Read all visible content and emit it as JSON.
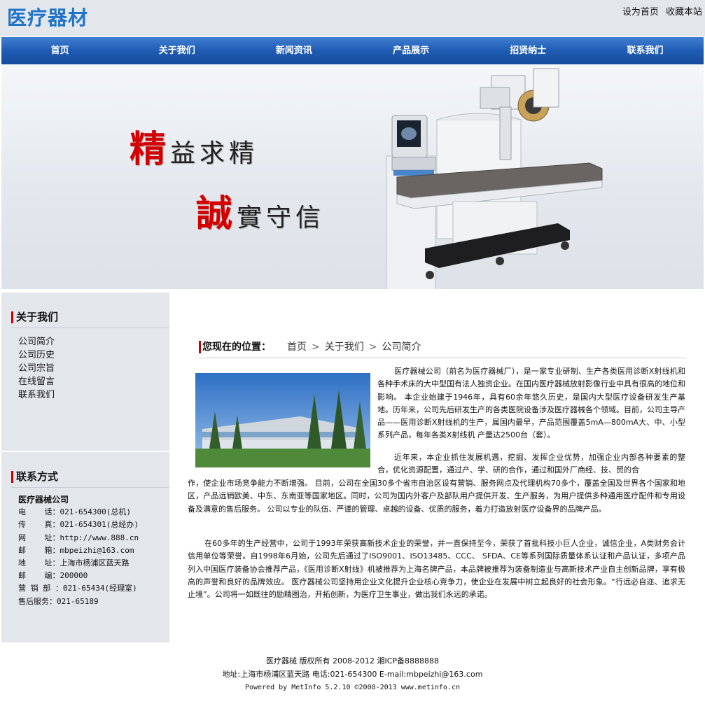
{
  "header": {
    "logo": "医疗器材",
    "set_home": "设为首页",
    "add_fav": "收藏本站"
  },
  "nav": [
    "首页",
    "关于我们",
    "新闻资讯",
    "产品展示",
    "招贤纳士",
    "联系我们"
  ],
  "banner": {
    "line1_big": "精",
    "line1_rest": "益求精",
    "line2_big": "誠",
    "line2_rest": "實守信"
  },
  "sidebar": {
    "about_title": "关于我们",
    "about_links": [
      "公司简介",
      "公司历史",
      "公司宗旨",
      "在线留言",
      "联系我们"
    ],
    "contact_title": "联系方式",
    "contact_company": "医疗器械公司",
    "contact_lines": [
      "电    话：021-654300(总机)",
      "传    真：021-654301(总经办)",
      "网    址：http://www.888.cn",
      "邮    箱：mbpeizhi@163.com",
      "地    址：上海市杨浦区蓝天路",
      "邮    编：200000",
      "营 销 部 ：021-65434(经理室)",
      "售后服务：021-65189"
    ]
  },
  "main": {
    "location_label": "您现在的位置：",
    "breadcrumb": [
      "首页",
      "关于我们",
      "公司简介"
    ],
    "para1_side": "医疗器械公司（前名为医疗器械厂），是一家专业研制、生产各类医用诊断X射线机和各种手术床的大中型国有法人独资企业。在国内医疗器械放射影像行业中具有很高的地位和影响。 本企业始建于1946年，具有60余年悠久历史，是国内大型医疗设备研发生产基地。历年来，公司先后研发生产的各类医院设备涉及医疗器械各个领域。目前，公司主导产品——医用诊断X射线机的生产，属国内最早，产品范围覆盖5mA—800mA大、中、小型系列产品，每年各类X射线机 产量达2500台（套）。",
    "para2_side": "近年来，本企业抓住发展机遇，挖掘、发挥企业优势，加强企业内部各种要素的整合，优化资源配置，通过产、学、研的合作，通过和国外厂商经、技、贸的合",
    "para2_full": "作，使企业市场竞争能力不断增强。 目前，公司在全国30多个省市自治区设有营销、服务网点及代理机构70多个，覆盖全国及世界各个国家和地区，产品远销欧美、中东、东南亚等国家地区。同时，公司为国内外客户及部队用户提供开发、生产服务，为用户提供多种通用医疗配件和专用设备及满意的售后服务。 公司以专业的队伍、严谨的管理、卓越的设备、优质的服务，着力打造放射医疗设备界的品牌产品。",
    "para3": "在60多年的生产经营中，公司于1993年荣获高新技术企业的荣誉，并一直保持至今，荣获了首批科技小巨人企业，诚信企业，A类财务会计信用单位等荣誉。自1998年6月始，公司先后通过了ISO9001、ISO13485、CCC、 SFDA、CE等系列国际质量体系认证和产品认证，多项产品列入中国医疗装备协会推荐产品，《医用诊断X射线》机被推荐为上海名牌产品，本品牌被推荐为装备制造业与高新技术产业自主创新品牌，享有极高的声誉和良好的品牌效应。 医疗器械公司坚持用企业文化提升企业核心竞争力，使企业在发展中树立起良好的社会形象。“行远必自迩、追求无止境”。公司将一如既往的励精图治，开拓创新，为医疗卫生事业，做出我们永远的承诺。"
  },
  "footer": {
    "line1": "医疗器械 版权所有 2008-2012 湘ICP备8888888",
    "line2": "地址:上海市杨浦区蓝天路 电话:021-654300 E-mail:mbpeizhi@163.com",
    "line3": "Powered by MetInfo 5.2.10 ©2008-2013 www.metinfo.cn"
  }
}
